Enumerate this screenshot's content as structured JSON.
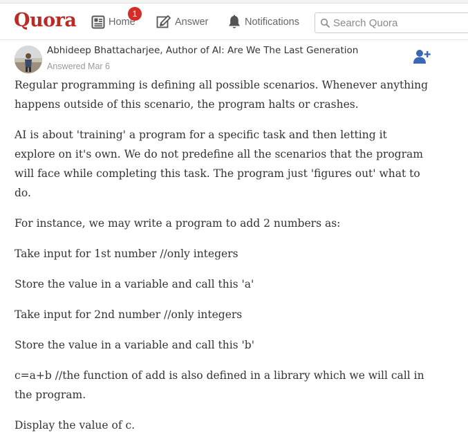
{
  "header": {
    "logo": "Quora",
    "nav": {
      "home": "Home",
      "home_badge": "1",
      "answer": "Answer",
      "notifications": "Notifications"
    },
    "search": {
      "placeholder": "Search Quora",
      "value": ""
    }
  },
  "answer": {
    "author_line": "Abhideep Bhattacharjee, Author of AI: Are We The Last Generation",
    "answered_date": "Answered Mar 6",
    "paragraphs": [
      "Regular programming is defining all possible scenarios. Whenever anything happens outside of this scenario, the program halts or crashes.",
      "AI is about 'training' a program for a specific task and then letting it explore on it's own. We do not predefine all the scenarios that the program will face while completing this task. The program just 'figures out' what to do.",
      "For instance, we may write a program to add 2 numbers as:",
      "Take input for 1st number //only integers",
      "Store the value in a variable and call this 'a'",
      "Take input for 2nd number //only integers",
      "Store the value in a variable and call this 'b'",
      "c=a+b //the function of add is also defined in a library which we will call in the program.",
      "Display the value of c."
    ]
  },
  "colors": {
    "brand": "#b92b27",
    "badge": "#d42c27",
    "follow_icon": "#3b68b5",
    "muted_text": "#999999"
  },
  "icons": {
    "home": "home-icon",
    "answer": "pencil-icon",
    "notifications": "bell-icon",
    "search": "search-icon",
    "follow": "add-user-icon"
  }
}
